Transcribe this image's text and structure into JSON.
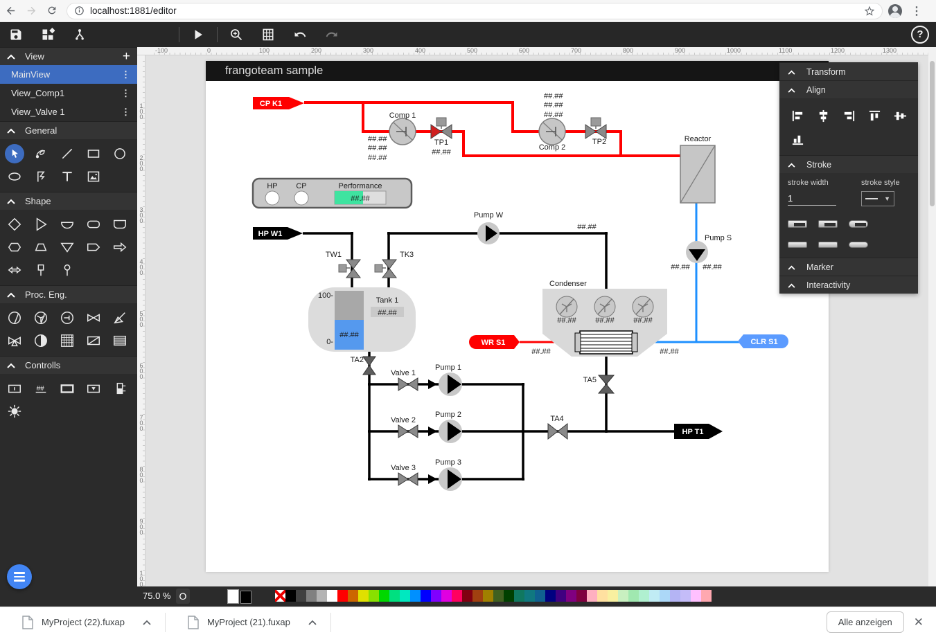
{
  "browser": {
    "url": "localhost:1881/editor"
  },
  "sidebar": {
    "view": {
      "title": "View",
      "items": [
        {
          "label": "MainView",
          "selected": true
        },
        {
          "label": "View_Comp1",
          "selected": false
        },
        {
          "label": "View_Valve 1",
          "selected": false
        }
      ]
    },
    "general_title": "General",
    "shape_title": "Shape",
    "proceng_title": "Proc. Eng.",
    "controls_title": "Controlls"
  },
  "rulers": {
    "h_labels": [
      "-100",
      "0",
      "100",
      "200",
      "300",
      "400",
      "500",
      "600",
      "700",
      "800",
      "900",
      "1000",
      "1100",
      "1200",
      "1300"
    ],
    "v_labels": [
      "100",
      "200",
      "300",
      "400",
      "500",
      "600",
      "700",
      "800",
      "900",
      "1000"
    ]
  },
  "canvas": {
    "title": "frangoteam sample",
    "value_placeholder": "##.##",
    "tags": {
      "cpk1": "CP K1",
      "hpw1": "HP W1",
      "wrs1": "WR S1",
      "clrs1": "CLR S1",
      "hpt1": "HP T1"
    },
    "labels": {
      "comp1": "Comp 1",
      "tp1": "TP1",
      "comp2": "Comp 2",
      "tp2": "TP2",
      "reactor": "Reactor",
      "pumpw": "Pump W",
      "pumps": "Pump S",
      "condenser": "Condenser",
      "tank": "Tank 1",
      "tw1": "TW1",
      "tk3": "TK3",
      "ta2": "TA2",
      "ta4": "TA4",
      "ta5": "TA5",
      "valve1": "Valve 1",
      "valve2": "Valve 2",
      "valve3": "Valve 3",
      "pump1": "Pump 1",
      "pump2": "Pump 2",
      "pump3": "Pump 3",
      "hp": "HP",
      "cp": "CP",
      "performance": "Performance",
      "scale_max": "100-",
      "scale_min": "0-"
    },
    "colors": {
      "pipe_red": "#FF0000",
      "pipe_blue": "#1E90FF",
      "pipe_black": "#000000",
      "tag_blue": "#5B9BFF",
      "device_fill": "#C6C6C6",
      "device_stroke": "#7E7E7E",
      "tank_fill": "#DCDCDC",
      "level_blue": "#5599EE",
      "perf_green": "#3FE3A0"
    }
  },
  "right_panel": {
    "transform": "Transform",
    "align": "Align",
    "stroke": {
      "title": "Stroke",
      "width_label": "stroke width",
      "width_value": "1",
      "style_label": "stroke style"
    },
    "marker": "Marker",
    "interactivity": "Interactivity"
  },
  "statusbar": {
    "zoom": "75.0 %",
    "origin": "O",
    "palette": [
      "none",
      "#000000",
      "#404040",
      "#808080",
      "#B3B3B3",
      "#FFFFFF",
      "#FF0000",
      "#CC6600",
      "#E0E000",
      "#88E000",
      "#00D800",
      "#00E080",
      "#00E8C0",
      "#0090FF",
      "#0000FF",
      "#8000FF",
      "#E000E0",
      "#FF0060",
      "#800010",
      "#A04010",
      "#A08000",
      "#406020",
      "#004000",
      "#107860",
      "#107880",
      "#106090",
      "#000080",
      "#400080",
      "#800080",
      "#800040",
      "#FFB0C0",
      "#FFE0A0",
      "#F8F0A0",
      "#C8F0C0",
      "#A0E8B0",
      "#B0F0D0",
      "#C0ECF4",
      "#ACD8F8",
      "#B4B4F4",
      "#C4BCF8",
      "#FFC0FF",
      "#FFA8B0"
    ]
  },
  "downloads": {
    "files": [
      {
        "name": "MyProject (22).fuxap"
      },
      {
        "name": "MyProject (21).fuxap"
      }
    ],
    "show_all": "Alle anzeigen"
  }
}
